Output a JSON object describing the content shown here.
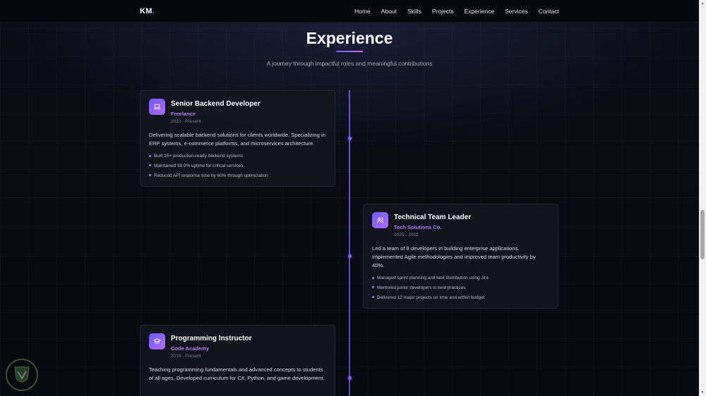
{
  "nav": {
    "logo": "KM",
    "logo_dot": ".",
    "links": [
      "Home",
      "About",
      "Skills",
      "Projects",
      "Experience",
      "Services",
      "Contact"
    ]
  },
  "section": {
    "title": "Experience",
    "subtitle": "A journey through impactful roles and meaningful contributions"
  },
  "experiences": [
    {
      "role": "Senior Backend Developer",
      "company": "Freelance",
      "period": "2022 - Present",
      "icon": "laptop-icon",
      "description": "Delivering scalable backend solutions for clients worldwide. Specializing in ERP systems, e-commerce platforms, and microservices architecture.",
      "achievements": [
        "Built 15+ production-ready backend systems",
        "Maintained 99.9% uptime for critical services",
        "Reduced API response time by 60% through optimization"
      ]
    },
    {
      "role": "Technical Team Leader",
      "company": "Tech Solutions Co.",
      "period": "2020 - 2022",
      "icon": "users-icon",
      "description": "Led a team of 8 developers in building enterprise applications. Implemented Agile methodologies and improved team productivity by 40%.",
      "achievements": [
        "Managed sprint planning and task distribution using Jira",
        "Mentored junior developers in best practices",
        "Delivered 12 major projects on time and within budget"
      ]
    },
    {
      "role": "Programming Instructor",
      "company": "Code Academy",
      "period": "2019 - Present",
      "icon": "graduation-cap-icon",
      "description": "Teaching programming fundamentals and advanced concepts to students of all ages. Developed curriculum for C#, Python, and game development.",
      "achievements": []
    }
  ],
  "colors": {
    "accent": "#9b6bff",
    "company": "#b77bff",
    "timeline": "#6b4fd8",
    "background": "#0a0b12",
    "card": "#14151e"
  }
}
